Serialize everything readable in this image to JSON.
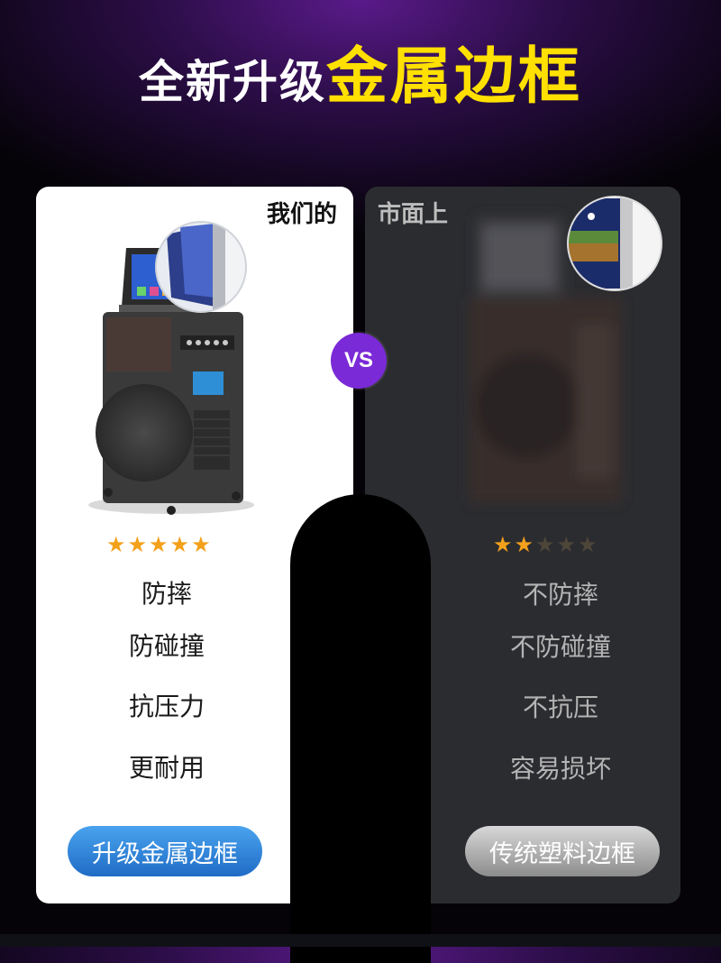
{
  "headline": {
    "white_text": "全新升级",
    "yellow_text": "金属边框"
  },
  "left": {
    "corner_label": "我们的",
    "rating": 5,
    "features": [
      "防摔",
      "防碰撞",
      "抗压力",
      "更耐用"
    ],
    "button_label": "升级金属边框"
  },
  "vs_label": "VS",
  "right": {
    "corner_label": "市面上",
    "rating": 2,
    "features": [
      "不防摔",
      "不防碰撞",
      "不抗压",
      "容易损坏"
    ],
    "button_label": "传统塑料边框"
  },
  "colors": {
    "yellow": "#ffe000",
    "purple": "#7a2ad6",
    "star": "#f3a01a",
    "blue": "#1f6cc6"
  },
  "icons": [
    "star-icon",
    "speaker-product-image",
    "frame-zoom-magnifier"
  ]
}
